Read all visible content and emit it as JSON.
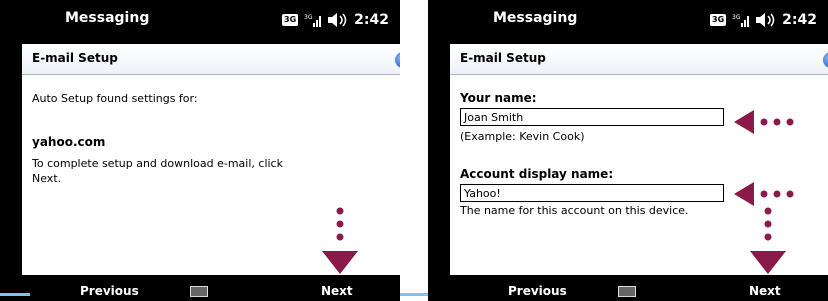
{
  "screens": [
    {
      "titlebar": {
        "app": "Messaging",
        "network": "3G",
        "signal_badge": "3G",
        "time": "2:42"
      },
      "header": {
        "title": "E-mail Setup",
        "help": "?"
      },
      "body": {
        "line1": "Auto Setup found settings for:",
        "domain": "yahoo.com",
        "instr1": "To complete setup and download e-mail, click",
        "instr2": "Next."
      },
      "softkeys": {
        "left": "Previous",
        "right": "Next"
      }
    },
    {
      "titlebar": {
        "app": "Messaging",
        "network": "3G",
        "signal_badge": "3G",
        "time": "2:42"
      },
      "header": {
        "title": "E-mail Setup",
        "help": "?"
      },
      "form": {
        "name_label": "Your name:",
        "name_value": "Joan Smith",
        "name_example": "(Example: Kevin Cook)",
        "account_label": "Account display name:",
        "account_value": "Yahoo!",
        "account_hint": "The name for this account on this device."
      },
      "softkeys": {
        "left": "Previous",
        "right": "Next"
      }
    }
  ],
  "colors": {
    "arrow": "#8a1a4a",
    "accent": "#7fc3e8"
  }
}
